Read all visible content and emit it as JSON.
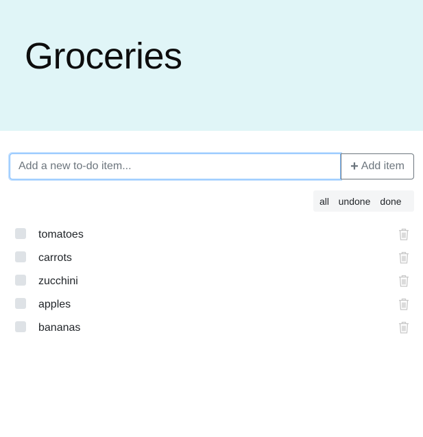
{
  "header": {
    "title": "Groceries"
  },
  "add_form": {
    "placeholder": "Add a new to-do item...",
    "button_label": "Add item",
    "button_icon": "plus-icon"
  },
  "filters": {
    "all": "all",
    "undone": "undone",
    "done": "done"
  },
  "todos": [
    {
      "label": "tomatoes",
      "done": false
    },
    {
      "label": "carrots",
      "done": false
    },
    {
      "label": "zucchini",
      "done": false
    },
    {
      "label": "apples",
      "done": false
    },
    {
      "label": "bananas",
      "done": false
    }
  ],
  "colors": {
    "header_background": "#e0f5f7",
    "checkbox": "#dee2e6",
    "trash_icon": "#c8c8c8",
    "input_focus_border": "#80bdff"
  }
}
